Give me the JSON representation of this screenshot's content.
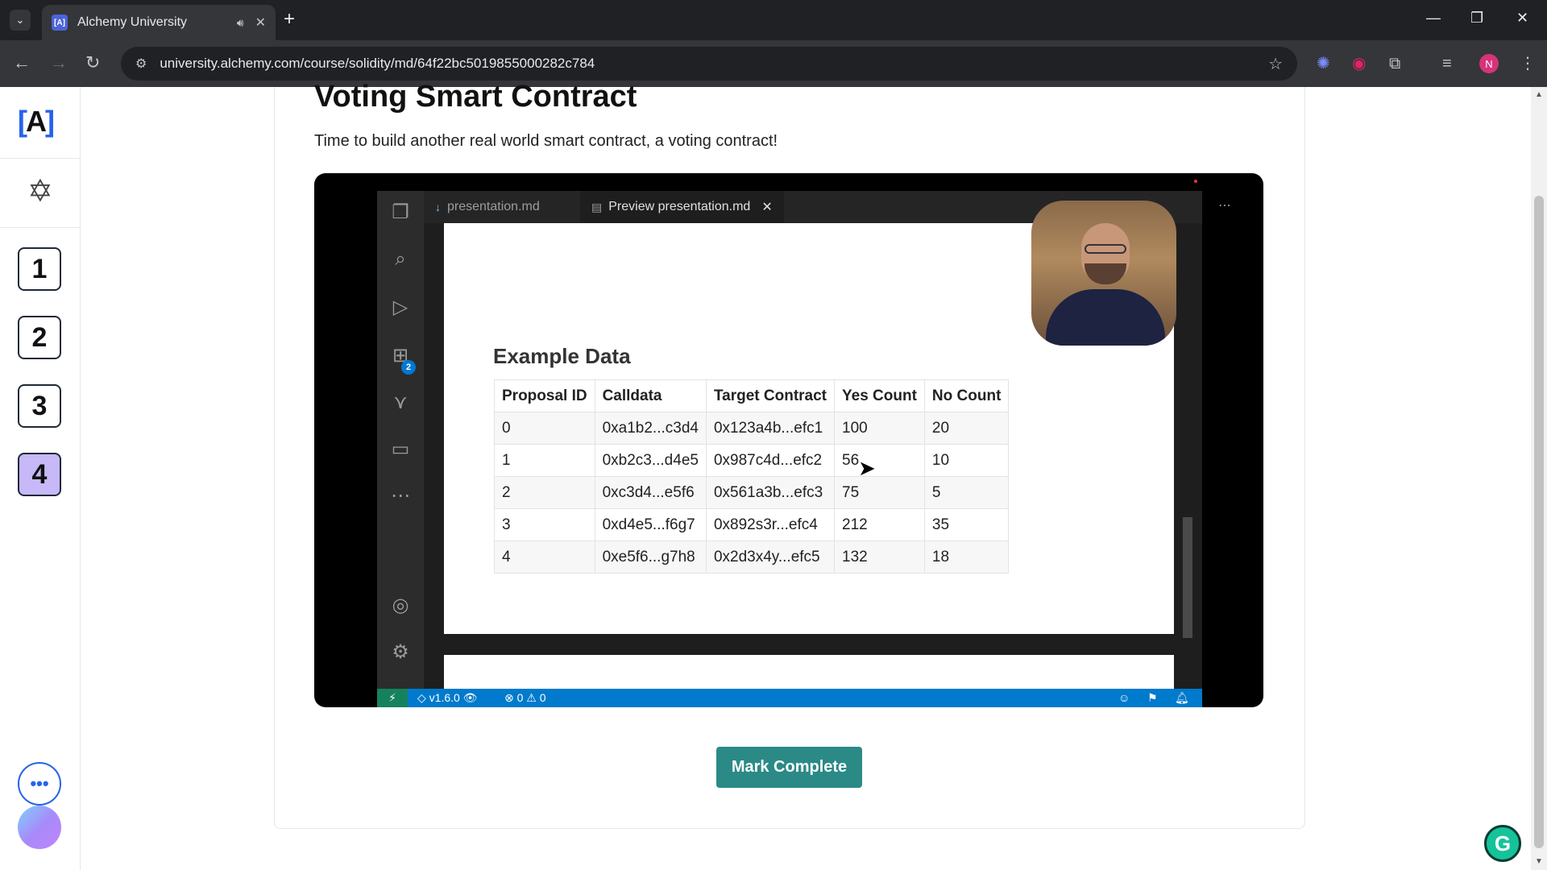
{
  "browser": {
    "tab_title": "Alchemy University",
    "tab_favicon_text": "[A]",
    "url": "university.alchemy.com/course/solidity/md/64f22bc5019855000282c784",
    "profile_initial": "N"
  },
  "sidebar": {
    "logo_text": "[",
    "logo_mid": "A",
    "logo_end": "]",
    "steps": [
      "1",
      "2",
      "3",
      "4"
    ],
    "active_step": "4",
    "more_label": "•••"
  },
  "lesson": {
    "title": "Voting Smart Contract",
    "description": "Time to build another real world smart contract, a voting contract!",
    "mark_complete_label": "Mark Complete"
  },
  "video": {
    "editor_tabs": [
      {
        "label": "presentation.md"
      },
      {
        "label": "Preview presentation.md"
      }
    ],
    "extension_badge": "2",
    "example_title": "Example Data",
    "table": {
      "headers": [
        "Proposal ID",
        "Calldata",
        "Target Contract",
        "Yes Count",
        "No Count"
      ],
      "rows": [
        [
          "0",
          "0xa1b2...c3d4",
          "0x123a4b...efc1",
          "100",
          "20"
        ],
        [
          "1",
          "0xb2c3...d4e5",
          "0x987c4d...efc2",
          "56",
          "10"
        ],
        [
          "2",
          "0xc3d4...e5f6",
          "0x561a3b...efc3",
          "75",
          "5"
        ],
        [
          "3",
          "0xd4e5...f6g7",
          "0x892s3r...efc4",
          "212",
          "35"
        ],
        [
          "4",
          "0xe5f6...g7h8",
          "0x2d3x4y...efc5",
          "132",
          "18"
        ]
      ]
    },
    "status": {
      "version": "v1.6.0",
      "errors": "0",
      "warnings": "0"
    }
  }
}
